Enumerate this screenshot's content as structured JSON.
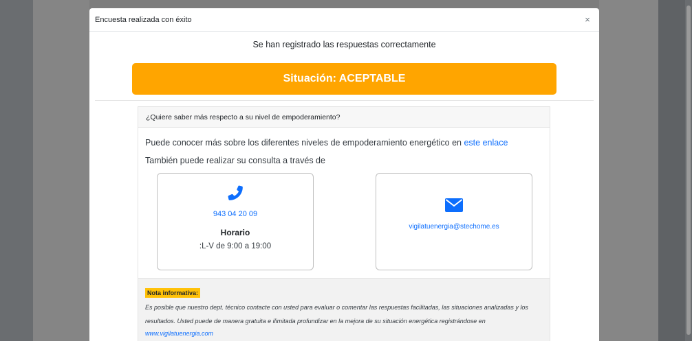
{
  "modal": {
    "title": "Encuesta realizada con éxito",
    "close": "×",
    "success_message": "Se han registrado las respuestas correctamente",
    "status": "Situación: ACEPTABLE",
    "status_color": "#ffa500"
  },
  "card": {
    "header": "¿Quiere saber más respecto a su nivel de empoderamiento?",
    "info_text": "Puede conocer más sobre los diferentes niveles de empoderamiento energético en ",
    "info_link": "este enlace",
    "consult_text": "También puede realizar su consulta a través de",
    "phone": {
      "icon": "phone-icon",
      "number": "943 04 20 09",
      "horario_title": "Horario",
      "horario_text": ":L-V de 9:00 a 19:00"
    },
    "mail": {
      "icon": "envelope-icon",
      "email": "vigilatuenergia@stechome.es"
    }
  },
  "nota": {
    "badge": "Nota informativa:",
    "text": "Es posible que nuestro dept. técnico contacte con usted para evaluar o comentar las respuestas facilitadas, las situaciones analizadas y los resultados. Usted puede de manera gratuita e ilimitada profundizar en la mejora de su situación energética registrándose en",
    "link": "www.vigilatuenergia.com"
  },
  "colors": {
    "accent": "#0d6efd",
    "badge": "#ffc107"
  }
}
